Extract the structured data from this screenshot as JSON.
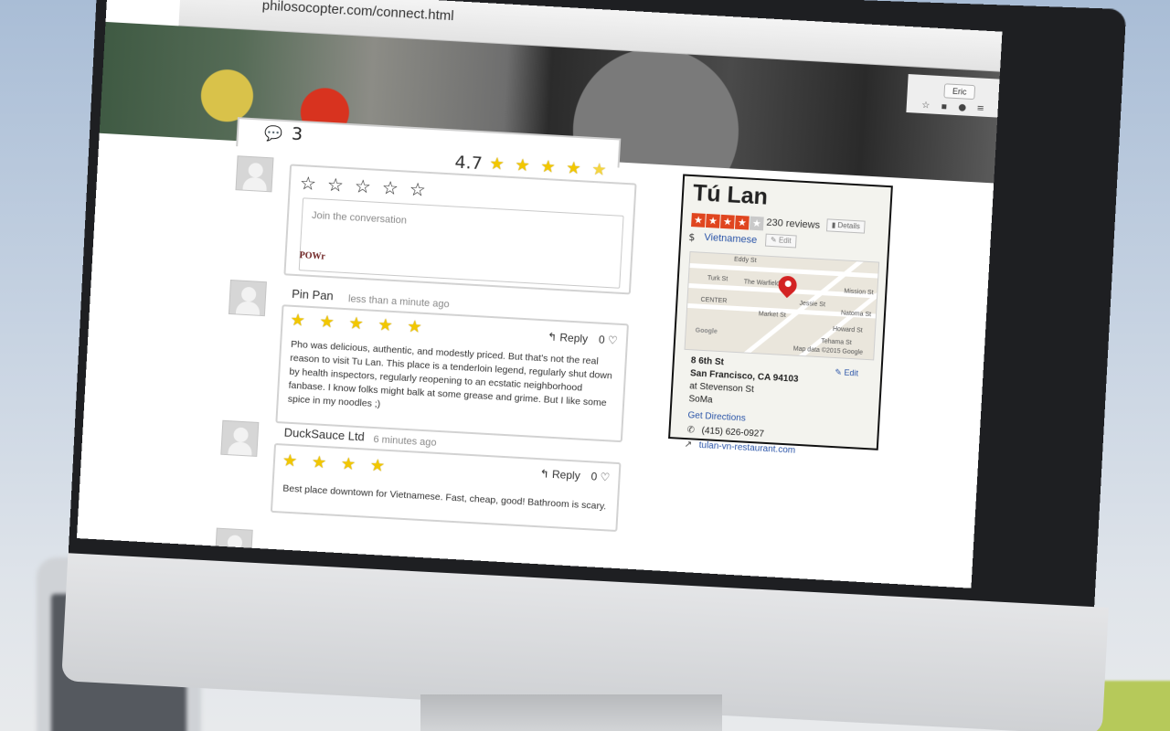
{
  "browser": {
    "url": "philosocopter.com/connect.html",
    "user": "Eric"
  },
  "comments_widget": {
    "count": "3",
    "average_rating": "4.7",
    "average_rating_value": 4.7,
    "composer": {
      "placeholder": "Join the conversation",
      "brand": "POWr"
    },
    "comments": [
      {
        "author": "Pin Pan",
        "time": "less than a minute ago",
        "stars": 5,
        "reply_label": "Reply",
        "likes": "0",
        "text": "Pho was delicious, authentic, and modestly priced. But that's not the real reason to visit Tu Lan. This place is a tenderloin legend, regularly shut down by health inspectors, regularly reopening to an ecstatic neighborhood fanbase. I know folks might balk at some grease and grime. But I like some spice in my noodles ;)"
      },
      {
        "author": "DuckSauce Ltd",
        "time": "6 minutes ago",
        "stars": 4,
        "reply_label": "Reply",
        "likes": "0",
        "text": "Best place downtown for Vietnamese. Fast, cheap, good! Bathroom is scary."
      }
    ]
  },
  "yelp_card": {
    "name": "Tú Lan",
    "stars": 4,
    "reviews": "230 reviews",
    "details_label": "Details",
    "price": "$",
    "category": "Vietnamese",
    "edit_label": "Edit",
    "map": {
      "streets": [
        "Eddy St",
        "Turk St",
        "The Warfield",
        "CENTER",
        "Market St",
        "Jessie St",
        "Mission St",
        "Natoma St",
        "Howard St",
        "Tehama St"
      ],
      "attribution": "Map data ©2015 Google",
      "logo": "Google"
    },
    "address_line1": "8 6th St",
    "address_line2": "San Francisco, CA 94103",
    "cross_street": "at Stevenson St",
    "neighborhood": "SoMa",
    "address_edit": "Edit",
    "directions": "Get Directions",
    "phone": "(415) 626-0927",
    "website": "tulan-vn-restaurant.com"
  },
  "colors": {
    "yelp_red": "#d32323",
    "star_gold": "#f2c700",
    "link_blue": "#2a54a8"
  }
}
